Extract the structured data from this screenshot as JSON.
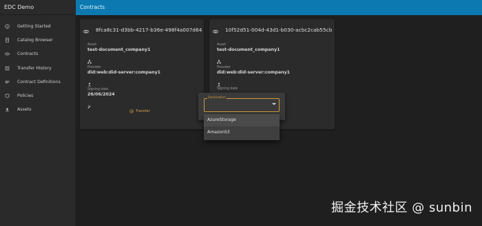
{
  "app": {
    "title": "EDC Demo"
  },
  "topbar": {
    "title": "Contracts"
  },
  "sidebar": {
    "items": [
      {
        "label": "Getting Started",
        "icon": "info-icon"
      },
      {
        "label": "Catalog Browser",
        "icon": "document-icon"
      },
      {
        "label": "Contracts",
        "icon": "handshake-icon"
      },
      {
        "label": "Transfer History",
        "icon": "history-icon"
      },
      {
        "label": "Contract Definitions",
        "icon": "checklist-icon"
      },
      {
        "label": "Policies",
        "icon": "policy-icon"
      },
      {
        "label": "Assets",
        "icon": "upload-icon"
      }
    ]
  },
  "cards": [
    {
      "id": "8fca8c31-d3bb-4217-b36e-498f4a007d64",
      "asset_label": "Asset",
      "asset_value": "test-document_company1",
      "provider_label": "Provider",
      "provider_value": "did:web:did-server:company1",
      "signing_label": "Signing date",
      "signing_value": "26/06/2024",
      "transfer_label": "Transfer"
    },
    {
      "id": "10f52d51-004d-43d1-b030-acbc2cab55cb",
      "asset_label": "Asset",
      "asset_value": "test-document_company1",
      "provider_label": "Provider",
      "provider_value": "did:web:did-server:company1",
      "signing_label": "Signing date"
    }
  ],
  "dialog": {
    "destination_label": "Destination",
    "options": [
      "AzureStorage",
      "AmazonS3"
    ]
  },
  "watermark": "掘金技术社区 @ sunbin",
  "colors": {
    "topbar": "#0c7ab1",
    "accent": "#d49a3a",
    "background": "#1f1f1f",
    "card": "#2b2b2b"
  }
}
